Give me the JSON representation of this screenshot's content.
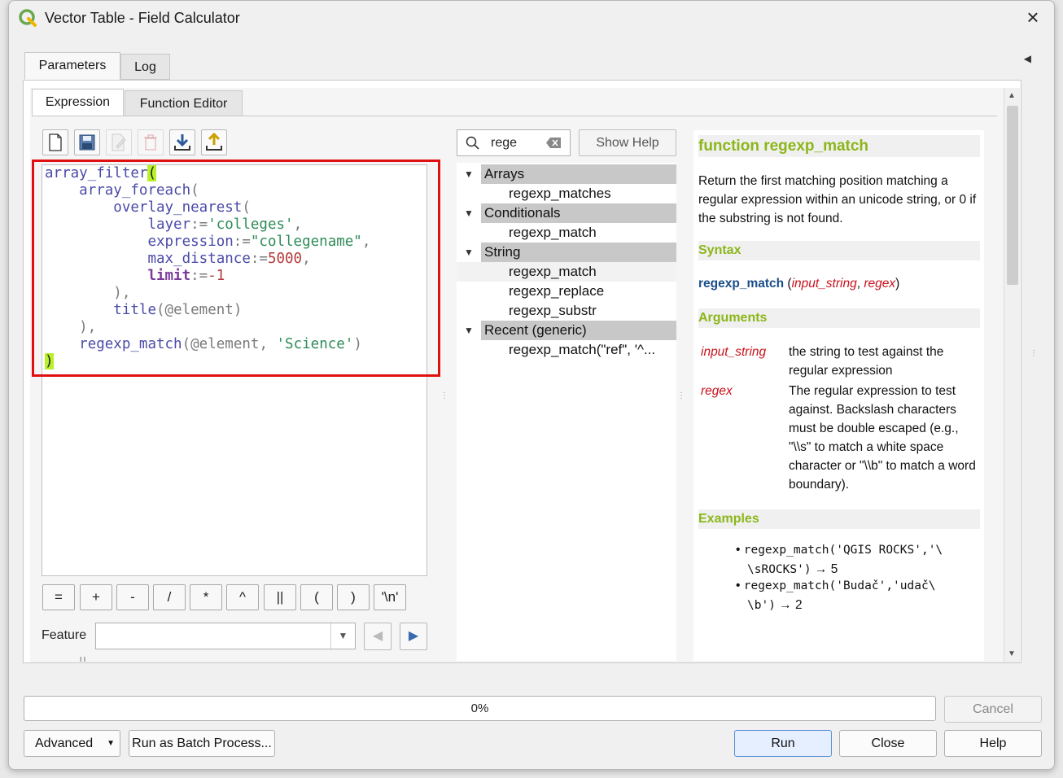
{
  "window": {
    "title": "Vector Table - Field Calculator"
  },
  "tabs": [
    "Parameters",
    "Log"
  ],
  "subtabs": [
    "Expression",
    "Function Editor"
  ],
  "editor_code": [
    "array_filter(",
    "    array_foreach(",
    "        overlay_nearest(",
    "            layer:='colleges',",
    "            expression:=\"collegename\",",
    "            max_distance:=5000,",
    "            limit:=-1",
    "        ),",
    "        title(@element)",
    "    ),",
    "    regexp_match(@element, 'Science')",
    ")"
  ],
  "operators": [
    "=",
    "+",
    "-",
    "/",
    "*",
    "^",
    "||",
    "(",
    ")",
    "'\\n'"
  ],
  "feature": {
    "label": "Feature",
    "value": ""
  },
  "search": {
    "value": "rege"
  },
  "show_help": "Show Help",
  "function_tree": [
    {
      "group": "Arrays",
      "items": [
        "regexp_matches"
      ]
    },
    {
      "group": "Conditionals",
      "items": [
        "regexp_match"
      ]
    },
    {
      "group": "String",
      "items": [
        "regexp_match",
        "regexp_replace",
        "regexp_substr"
      ]
    },
    {
      "group": "Recent (generic)",
      "items": [
        "regexp_match(\"ref\", '^..."
      ]
    }
  ],
  "help": {
    "title": "function regexp_match",
    "description": "Return the first matching position matching a regular expression within an unicode string, or 0 if the substring is not found.",
    "syntax_header": "Syntax",
    "syntax_fn": "regexp_match",
    "syntax_args": [
      "input_string",
      "regex"
    ],
    "arguments_header": "Arguments",
    "arguments": [
      {
        "name": "input_string",
        "desc": "the string to test against the regular expression"
      },
      {
        "name": "regex",
        "desc": "The regular expression to test against. Backslash characters must be double escaped (e.g., \"\\\\s\" to match a white space character or \"\\\\b\" to match a word boundary)."
      }
    ],
    "examples_header": "Examples",
    "examples": [
      {
        "code1": "regexp_match('QGIS ROCKS','\\",
        "code2": "\\sROCKS')",
        "result": "5"
      },
      {
        "code1": "regexp_match('Budač','udač\\",
        "code2": "\\b')",
        "result": "2"
      }
    ]
  },
  "progress": {
    "text": "0%",
    "value": 0
  },
  "buttons": {
    "cancel": "Cancel",
    "advanced": "Advanced",
    "batch": "Run as Batch Process...",
    "run": "Run",
    "close": "Close",
    "help": "Help"
  },
  "colors": {
    "accent_green": "#8cb61a",
    "highlight_red": "#e01010",
    "arg_red": "#c8121c"
  }
}
